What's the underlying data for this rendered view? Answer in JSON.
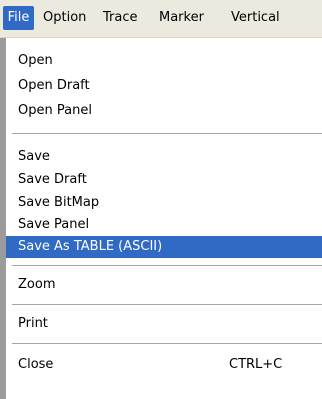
{
  "menubar": {
    "items": [
      {
        "label": "File"
      },
      {
        "label": "Option"
      },
      {
        "label": "Trace"
      },
      {
        "label": "Marker"
      },
      {
        "label": "Vertical"
      }
    ]
  },
  "file_menu": {
    "open": "Open",
    "open_draft": "Open Draft",
    "open_panel": "Open Panel",
    "save": "Save",
    "save_draft": "Save Draft",
    "save_bitmap": "Save BitMap",
    "save_panel": "Save Panel",
    "save_as_table": "Save As TABLE (ASCII)",
    "zoom": "Zoom",
    "print": "Print",
    "close": "Close",
    "close_shortcut": "CTRL+C"
  },
  "colors": {
    "highlight": "#316ac5",
    "menubar_bg": "#eceade",
    "gutter": "#9b9b9b",
    "separator": "#a7a6aa"
  }
}
